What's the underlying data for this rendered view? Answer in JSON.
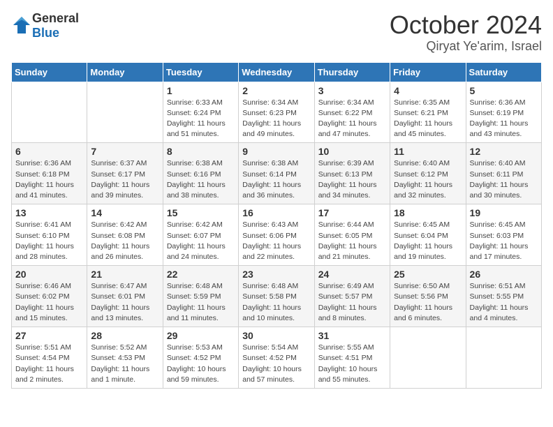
{
  "logo": {
    "general": "General",
    "blue": "Blue"
  },
  "title": "October 2024",
  "subtitle": "Qiryat Ye'arim, Israel",
  "days_of_week": [
    "Sunday",
    "Monday",
    "Tuesday",
    "Wednesday",
    "Thursday",
    "Friday",
    "Saturday"
  ],
  "weeks": [
    [
      {
        "day": "",
        "sunrise": "",
        "sunset": "",
        "daylight": ""
      },
      {
        "day": "",
        "sunrise": "",
        "sunset": "",
        "daylight": ""
      },
      {
        "day": "1",
        "sunrise": "Sunrise: 6:33 AM",
        "sunset": "Sunset: 6:24 PM",
        "daylight": "Daylight: 11 hours and 51 minutes."
      },
      {
        "day": "2",
        "sunrise": "Sunrise: 6:34 AM",
        "sunset": "Sunset: 6:23 PM",
        "daylight": "Daylight: 11 hours and 49 minutes."
      },
      {
        "day": "3",
        "sunrise": "Sunrise: 6:34 AM",
        "sunset": "Sunset: 6:22 PM",
        "daylight": "Daylight: 11 hours and 47 minutes."
      },
      {
        "day": "4",
        "sunrise": "Sunrise: 6:35 AM",
        "sunset": "Sunset: 6:21 PM",
        "daylight": "Daylight: 11 hours and 45 minutes."
      },
      {
        "day": "5",
        "sunrise": "Sunrise: 6:36 AM",
        "sunset": "Sunset: 6:19 PM",
        "daylight": "Daylight: 11 hours and 43 minutes."
      }
    ],
    [
      {
        "day": "6",
        "sunrise": "Sunrise: 6:36 AM",
        "sunset": "Sunset: 6:18 PM",
        "daylight": "Daylight: 11 hours and 41 minutes."
      },
      {
        "day": "7",
        "sunrise": "Sunrise: 6:37 AM",
        "sunset": "Sunset: 6:17 PM",
        "daylight": "Daylight: 11 hours and 39 minutes."
      },
      {
        "day": "8",
        "sunrise": "Sunrise: 6:38 AM",
        "sunset": "Sunset: 6:16 PM",
        "daylight": "Daylight: 11 hours and 38 minutes."
      },
      {
        "day": "9",
        "sunrise": "Sunrise: 6:38 AM",
        "sunset": "Sunset: 6:14 PM",
        "daylight": "Daylight: 11 hours and 36 minutes."
      },
      {
        "day": "10",
        "sunrise": "Sunrise: 6:39 AM",
        "sunset": "Sunset: 6:13 PM",
        "daylight": "Daylight: 11 hours and 34 minutes."
      },
      {
        "day": "11",
        "sunrise": "Sunrise: 6:40 AM",
        "sunset": "Sunset: 6:12 PM",
        "daylight": "Daylight: 11 hours and 32 minutes."
      },
      {
        "day": "12",
        "sunrise": "Sunrise: 6:40 AM",
        "sunset": "Sunset: 6:11 PM",
        "daylight": "Daylight: 11 hours and 30 minutes."
      }
    ],
    [
      {
        "day": "13",
        "sunrise": "Sunrise: 6:41 AM",
        "sunset": "Sunset: 6:10 PM",
        "daylight": "Daylight: 11 hours and 28 minutes."
      },
      {
        "day": "14",
        "sunrise": "Sunrise: 6:42 AM",
        "sunset": "Sunset: 6:08 PM",
        "daylight": "Daylight: 11 hours and 26 minutes."
      },
      {
        "day": "15",
        "sunrise": "Sunrise: 6:42 AM",
        "sunset": "Sunset: 6:07 PM",
        "daylight": "Daylight: 11 hours and 24 minutes."
      },
      {
        "day": "16",
        "sunrise": "Sunrise: 6:43 AM",
        "sunset": "Sunset: 6:06 PM",
        "daylight": "Daylight: 11 hours and 22 minutes."
      },
      {
        "day": "17",
        "sunrise": "Sunrise: 6:44 AM",
        "sunset": "Sunset: 6:05 PM",
        "daylight": "Daylight: 11 hours and 21 minutes."
      },
      {
        "day": "18",
        "sunrise": "Sunrise: 6:45 AM",
        "sunset": "Sunset: 6:04 PM",
        "daylight": "Daylight: 11 hours and 19 minutes."
      },
      {
        "day": "19",
        "sunrise": "Sunrise: 6:45 AM",
        "sunset": "Sunset: 6:03 PM",
        "daylight": "Daylight: 11 hours and 17 minutes."
      }
    ],
    [
      {
        "day": "20",
        "sunrise": "Sunrise: 6:46 AM",
        "sunset": "Sunset: 6:02 PM",
        "daylight": "Daylight: 11 hours and 15 minutes."
      },
      {
        "day": "21",
        "sunrise": "Sunrise: 6:47 AM",
        "sunset": "Sunset: 6:01 PM",
        "daylight": "Daylight: 11 hours and 13 minutes."
      },
      {
        "day": "22",
        "sunrise": "Sunrise: 6:48 AM",
        "sunset": "Sunset: 5:59 PM",
        "daylight": "Daylight: 11 hours and 11 minutes."
      },
      {
        "day": "23",
        "sunrise": "Sunrise: 6:48 AM",
        "sunset": "Sunset: 5:58 PM",
        "daylight": "Daylight: 11 hours and 10 minutes."
      },
      {
        "day": "24",
        "sunrise": "Sunrise: 6:49 AM",
        "sunset": "Sunset: 5:57 PM",
        "daylight": "Daylight: 11 hours and 8 minutes."
      },
      {
        "day": "25",
        "sunrise": "Sunrise: 6:50 AM",
        "sunset": "Sunset: 5:56 PM",
        "daylight": "Daylight: 11 hours and 6 minutes."
      },
      {
        "day": "26",
        "sunrise": "Sunrise: 6:51 AM",
        "sunset": "Sunset: 5:55 PM",
        "daylight": "Daylight: 11 hours and 4 minutes."
      }
    ],
    [
      {
        "day": "27",
        "sunrise": "Sunrise: 5:51 AM",
        "sunset": "Sunset: 4:54 PM",
        "daylight": "Daylight: 11 hours and 2 minutes."
      },
      {
        "day": "28",
        "sunrise": "Sunrise: 5:52 AM",
        "sunset": "Sunset: 4:53 PM",
        "daylight": "Daylight: 11 hours and 1 minute."
      },
      {
        "day": "29",
        "sunrise": "Sunrise: 5:53 AM",
        "sunset": "Sunset: 4:52 PM",
        "daylight": "Daylight: 10 hours and 59 minutes."
      },
      {
        "day": "30",
        "sunrise": "Sunrise: 5:54 AM",
        "sunset": "Sunset: 4:52 PM",
        "daylight": "Daylight: 10 hours and 57 minutes."
      },
      {
        "day": "31",
        "sunrise": "Sunrise: 5:55 AM",
        "sunset": "Sunset: 4:51 PM",
        "daylight": "Daylight: 10 hours and 55 minutes."
      },
      {
        "day": "",
        "sunrise": "",
        "sunset": "",
        "daylight": ""
      },
      {
        "day": "",
        "sunrise": "",
        "sunset": "",
        "daylight": ""
      }
    ]
  ]
}
